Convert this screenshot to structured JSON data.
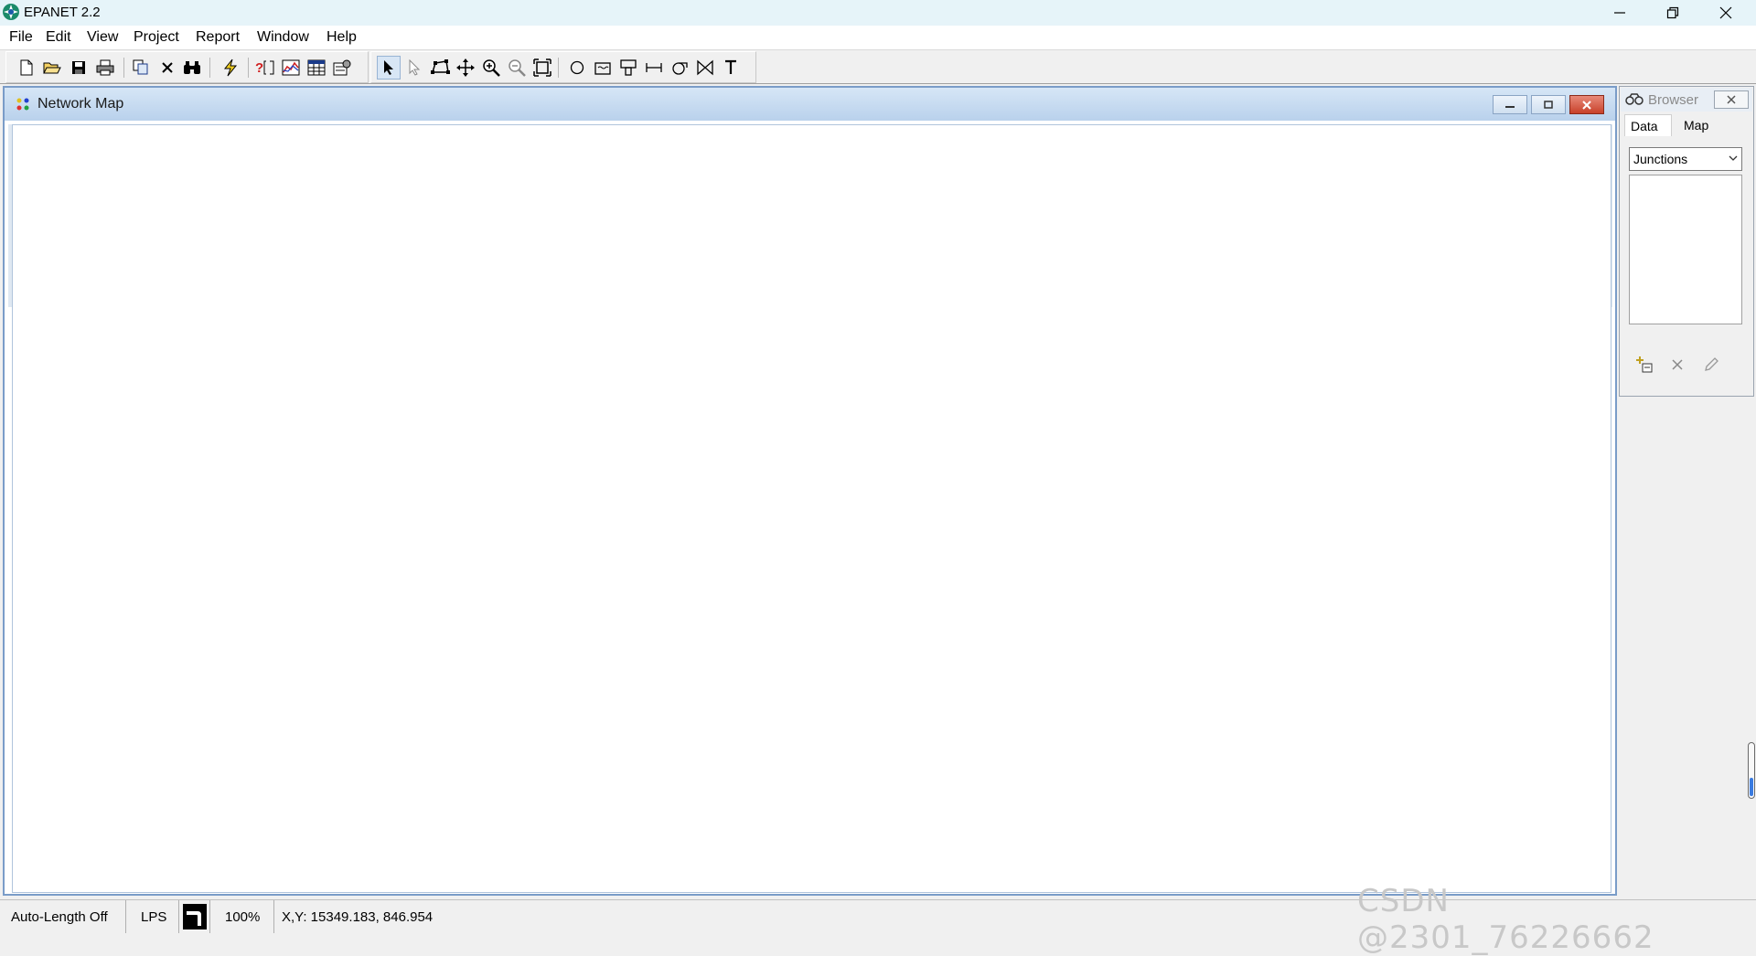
{
  "window": {
    "title": "EPANET 2.2"
  },
  "menu": [
    "File",
    "Edit",
    "View",
    "Project",
    "Report",
    "Window",
    "Help"
  ],
  "toolbar": {
    "left_icons": [
      "new-file-icon",
      "open-folder-icon",
      "save-icon",
      "print-icon",
      "copy-icon",
      "delete-icon",
      "find-icon",
      "run-icon",
      "query-icon",
      "graph-icon",
      "table-icon",
      "options-icon"
    ],
    "right_icons": [
      "select-object-icon",
      "select-vertex-icon",
      "select-region-icon",
      "pan-icon",
      "zoom-in-icon",
      "zoom-out-icon",
      "full-extent-icon",
      "add-junction-icon",
      "add-reservoir-icon",
      "add-tank-icon",
      "add-pipe-icon",
      "add-pump-icon",
      "add-valve-icon",
      "add-label-icon"
    ]
  },
  "network_map": {
    "title": "Network Map"
  },
  "browser": {
    "title": "Browser",
    "tabs": [
      "Data",
      "Map"
    ],
    "active_tab": "Data",
    "category": "Junctions"
  },
  "status": {
    "auto_length": "Auto-Length Off",
    "units": "LPS",
    "zoom": "100%",
    "xy": "X,Y: 15349.183, 846.954"
  },
  "watermark": "CSDN @2301_76226662"
}
